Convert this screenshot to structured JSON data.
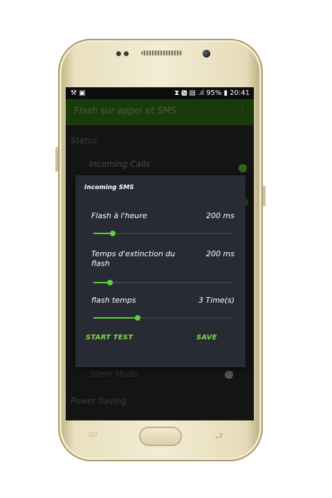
{
  "statusbar": {
    "left_icons": "⚒ ▣",
    "right_text": "⧗ 🅽 ▤ .ıl 95% ▮ 20:41"
  },
  "appbar": {
    "title": "Flash sur appel et SMS",
    "menu_icon": "⋮"
  },
  "background": {
    "status_header": "Status",
    "incoming_calls": "Incoming Calls",
    "silent_mode": "Silent Mode",
    "power_saving": "Power Saving",
    "accent_green": "#5fd43a"
  },
  "dialog": {
    "title": "Incoming SMS",
    "settings": [
      {
        "label": "Flash à l'heure",
        "value": "200 ms",
        "level": 0.14
      },
      {
        "label": "Temps d'extinction du flash",
        "value": "200 ms",
        "level": 0.12
      },
      {
        "label": "flash temps",
        "value": "3 Time(s)",
        "level": 0.32
      }
    ],
    "start_test": "START TEST",
    "save": "SAVE"
  },
  "navbar": {
    "recents_icon": "▭",
    "back_icon": "⮐"
  }
}
